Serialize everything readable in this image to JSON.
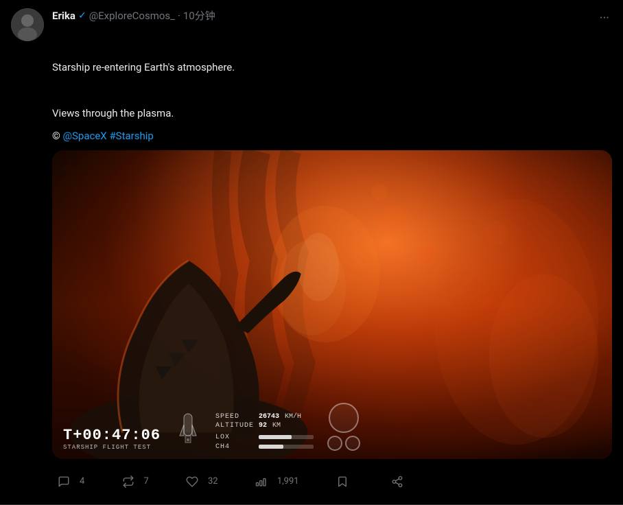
{
  "tweet": {
    "user": {
      "display_name": "Erika",
      "username": "@ExploreCosmos_",
      "timestamp": "10分钟",
      "avatar_alt": "Erika avatar"
    },
    "text_line1": "Starship re-entering Earth's atmosphere.",
    "text_line2": "Views through the plasma.",
    "copyright": "©",
    "mention": "@SpaceX",
    "hashtag": "#Starship",
    "more_label": "···"
  },
  "hud": {
    "timer": "T+00:47:06",
    "timer_label": "STARSHIP FLIGHT TEST",
    "speed_label": "SPEED",
    "speed_value": "26743",
    "speed_unit": "KM/H",
    "altitude_label": "ALTITUDE",
    "altitude_value": "92",
    "altitude_unit": "KM",
    "lox_label": "LOX",
    "ch4_label": "CH4",
    "lox_fill": 60,
    "ch4_fill": 45
  },
  "actions": {
    "reply_count": "4",
    "retweet_count": "7",
    "like_count": "32",
    "views_count": "1,991",
    "reply_label": "Reply",
    "retweet_label": "Retweet",
    "like_label": "Like",
    "views_label": "Views",
    "bookmark_label": "Bookmark",
    "share_label": "Share"
  },
  "colors": {
    "accent": "#1d9bf0",
    "bg": "#000000",
    "text_primary": "#e7e9ea",
    "text_secondary": "#71767b"
  }
}
